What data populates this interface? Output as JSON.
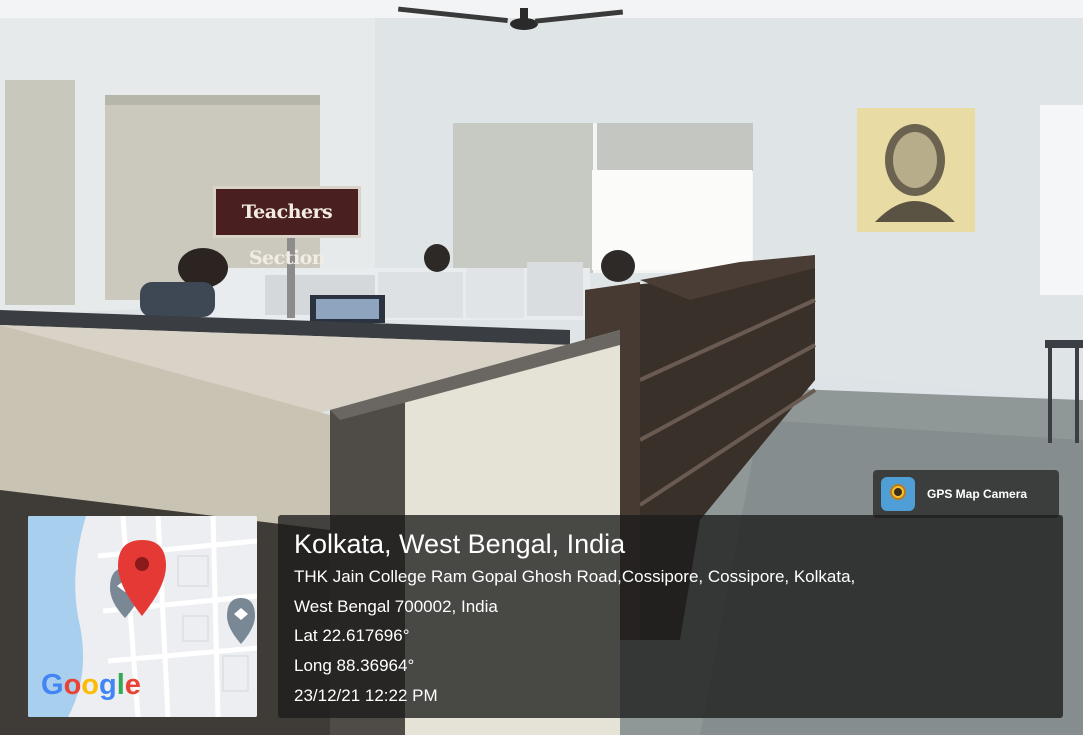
{
  "scene": {
    "sign_text": "Teachers Section"
  },
  "overlay": {
    "app_name": "GPS Map Camera",
    "app_icon": "gps-camera-icon",
    "map_logo": "Google",
    "location_title": "Kolkata, West Bengal, India",
    "address_line_1": "THK Jain College Ram Gopal Ghosh Road,Cossipore, Cossipore, Kolkata,",
    "address_line_2": "West Bengal 700002, India",
    "latitude": "Lat 22.617696°",
    "longitude": "Long 88.36964°",
    "datetime": "23/12/21 12:22 PM"
  },
  "colors": {
    "pin_red": "#e53935",
    "overlay_bg": "#1c1c1c",
    "sign_bg": "#4a1f1f"
  }
}
